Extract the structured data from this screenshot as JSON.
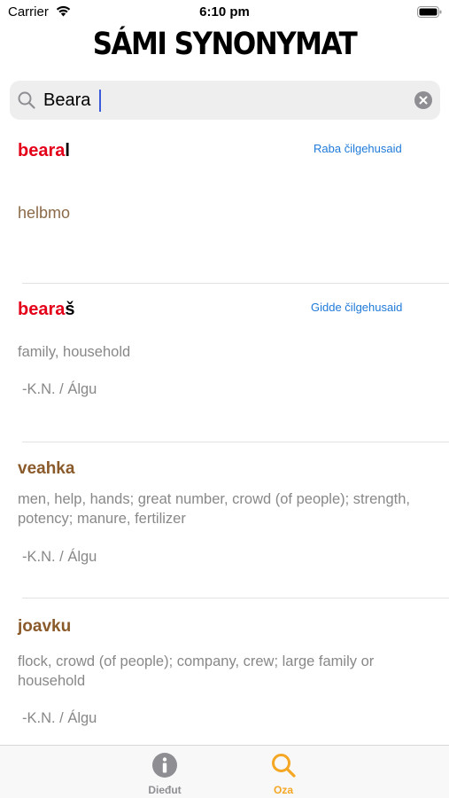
{
  "status_bar": {
    "carrier": "Carrier",
    "time": "6:10 pm"
  },
  "header": {
    "title": "SÁMI SYNONYMAT"
  },
  "search": {
    "value": "Beara",
    "placeholder": ""
  },
  "entries": [
    {
      "headword_match": "beara",
      "headword_rest": "l",
      "conjugation_link": "Raba čilgehusaid",
      "synonym": "helbmo"
    },
    {
      "headword_match": "beara",
      "headword_rest": "š",
      "conjugation_link": "Gidde čilgehusaid",
      "definition": "family, household",
      "source": "-K.N. / Álgu"
    },
    {
      "headword": "veahka",
      "definition": "men, help, hands; great number, crowd (of people); strength, potency; manure, fertilizer",
      "source": "-K.N. / Álgu"
    },
    {
      "headword": "joavku",
      "definition": "flock, crowd (of people); company, crew; large family or household",
      "source": "-K.N. / Álgu"
    }
  ],
  "tab_bar": {
    "tabs": [
      {
        "label": "Dieđut",
        "icon": "info-icon",
        "active": false
      },
      {
        "label": "Oza",
        "icon": "search-icon",
        "active": true
      }
    ]
  },
  "colors": {
    "match_highlight": "#e5001a",
    "link": "#1e7ad9",
    "synonym_brown": "#8b6a48",
    "active_tab": "#f5a623",
    "inactive_tab": "#8e8e93"
  }
}
